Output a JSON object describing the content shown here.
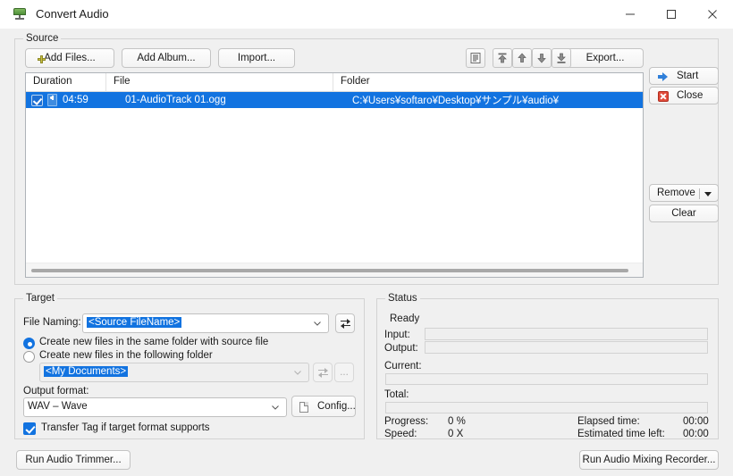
{
  "window": {
    "title": "Convert Audio",
    "icon": "app-icon",
    "minimize_label": "—",
    "maximize_label": "□",
    "close_label": "✕"
  },
  "source": {
    "group_label": "Source",
    "buttons": {
      "add_files": "Add Files...",
      "add_album": "Add Album...",
      "import": "Import...",
      "export": "Export..."
    },
    "toolbar_icons": [
      "properties-icon",
      "move-to-top-icon",
      "move-up-icon",
      "move-down-icon",
      "move-to-bottom-icon"
    ],
    "list": {
      "columns": [
        "Duration",
        "File",
        "Folder"
      ],
      "rows": [
        {
          "checked": true,
          "duration": "04:59",
          "file": "01-AudioTrack 01.ogg",
          "folder": "C:¥Users¥softaro¥Desktop¥サンプル¥audio¥",
          "selected": true
        }
      ]
    },
    "side_buttons": {
      "start": "Start",
      "close": "Close",
      "remove": "Remove",
      "clear": "Clear"
    }
  },
  "target": {
    "group_label": "Target",
    "file_naming_label": "File Naming:",
    "file_naming_value": "<Source FileName>",
    "radio_same_folder": "Create new files in the same folder with source file",
    "radio_following_folder": "Create new files in the following folder",
    "radio_selected": "same_folder",
    "folder_value": "<My Documents>",
    "folder_browse_label": "...",
    "output_format_label": "Output format:",
    "output_format_value": "WAV – Wave",
    "config_label": "Config...",
    "transfer_tag_label": "Transfer Tag if target format supports",
    "transfer_tag_checked": true
  },
  "status": {
    "group_label": "Status",
    "ready": "Ready",
    "input_label": "Input:",
    "input_value": "",
    "output_label": "Output:",
    "output_value": "",
    "current_label": "Current:",
    "current_percent": 0,
    "total_label": "Total:",
    "total_percent": 0,
    "progress_label": "Progress:",
    "progress_value": "0 %",
    "speed_label": "Speed:",
    "speed_value": "0 X",
    "elapsed_label": "Elapsed time:",
    "elapsed_value": "00:00",
    "eta_label": "Estimated time left:",
    "eta_value": "00:00"
  },
  "footer": {
    "run_trimmer": "Run Audio Trimmer...",
    "run_mixer": "Run Audio Mixing Recorder..."
  },
  "colors": {
    "selection_blue": "#1273e0",
    "window_bg": "#f0f0f0",
    "titlebar_bg": "#ffffff",
    "accent_red": "#e14b3a"
  }
}
